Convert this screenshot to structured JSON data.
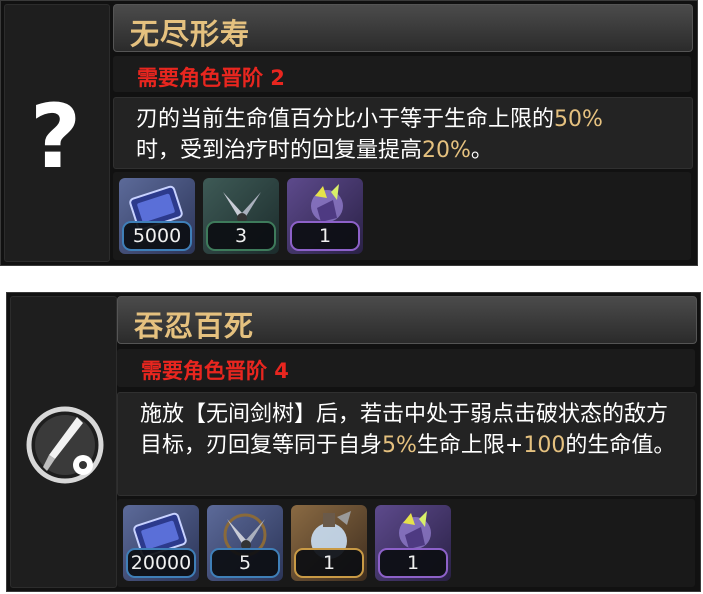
{
  "cards": [
    {
      "title": "无尽形寿",
      "requirement": "需要角色晋阶 2",
      "icon": "question-mark-icon",
      "icon_glyph": "?",
      "desc_parts": [
        {
          "text": "刃的当前生命值百分比小于等于生命上限的",
          "hl": false
        },
        {
          "text": "50%",
          "hl": true
        },
        {
          "text": "时，受到治疗时的回复量提高",
          "hl": false
        },
        {
          "text": "20%",
          "hl": true
        },
        {
          "text": "。",
          "hl": false
        }
      ],
      "materials": [
        {
          "icon": "credit-icon",
          "count": "5000",
          "rarity": "blue"
        },
        {
          "icon": "shattered-blade-icon",
          "count": "3",
          "rarity": "green"
        },
        {
          "icon": "crystal-ore-icon",
          "count": "1",
          "rarity": "purple"
        }
      ]
    },
    {
      "title": "吞忍百死",
      "requirement": "需要角色晋阶 4",
      "icon": "sword-skill-icon",
      "desc_parts": [
        {
          "text": "施放【无间剑树】后，若击中处于弱点击破状态的敌方目标，刃回复等同于自身",
          "hl": false
        },
        {
          "text": "5%",
          "hl": true
        },
        {
          "text": "生命上限+",
          "hl": false
        },
        {
          "text": "100",
          "hl": true
        },
        {
          "text": "的生命值。",
          "hl": false
        }
      ],
      "materials": [
        {
          "icon": "credit-icon",
          "count": "20000",
          "rarity": "blue"
        },
        {
          "icon": "shattered-blade-icon",
          "count": "5",
          "rarity": "blue"
        },
        {
          "icon": "flask-orb-icon",
          "count": "1",
          "rarity": "gold"
        },
        {
          "icon": "crystal-ore-icon",
          "count": "1",
          "rarity": "purple"
        }
      ]
    }
  ],
  "colors": {
    "title": "#e5c17f",
    "requirement": "#e8261f",
    "highlight": "#e5c17f",
    "text": "#ffffff",
    "panel": "#111111"
  }
}
